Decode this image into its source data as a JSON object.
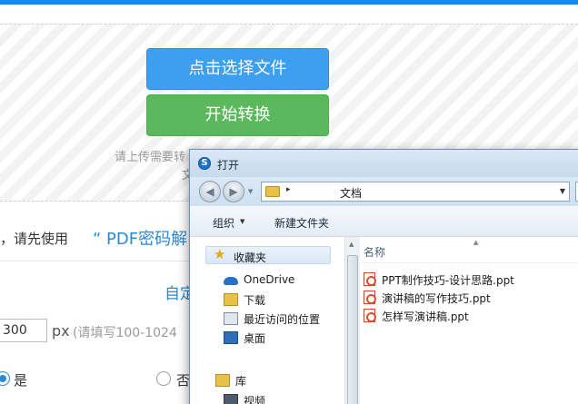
{
  "page": {
    "select_button": "点击选择文件",
    "convert_button": "开始转换",
    "hint_line1": "请上传需要转",
    "hint_line2": "文",
    "notice_text": "，请先使用",
    "notice_link": "“ PDF密码解",
    "custom_label": "自定",
    "px_value": "300",
    "px_unit": "px",
    "px_note": "(请填写100-1024",
    "option_yes": "是",
    "option_no": "否",
    "accent_color": "#2a8ad6",
    "select_button_color": "#3d9ff0",
    "convert_button_color": "#5cb85c"
  },
  "dialog": {
    "title": "打开",
    "address": {
      "separator": "▸",
      "current_folder": "文档"
    },
    "toolbar": {
      "organize": "组织",
      "new_folder": "新建文件夹"
    },
    "nav": {
      "favorites": "收藏夹",
      "items": [
        {
          "label": "OneDrive",
          "icon": "onedrive-icon"
        },
        {
          "label": "下载",
          "icon": "download-folder-icon"
        },
        {
          "label": "最近访问的位置",
          "icon": "recent-places-icon"
        },
        {
          "label": "桌面",
          "icon": "desktop-icon"
        }
      ],
      "library": "库",
      "library_items": [
        {
          "label": "视频",
          "icon": "video-icon"
        }
      ]
    },
    "files": {
      "column_name": "名称",
      "items": [
        {
          "name": "PPT制作技巧-设计思路.ppt",
          "icon": "ppt-file-icon"
        },
        {
          "name": "演讲稿的写作技巧.ppt",
          "icon": "ppt-file-icon"
        },
        {
          "name": "怎样写演讲稿.ppt",
          "icon": "ppt-file-icon"
        }
      ]
    }
  }
}
